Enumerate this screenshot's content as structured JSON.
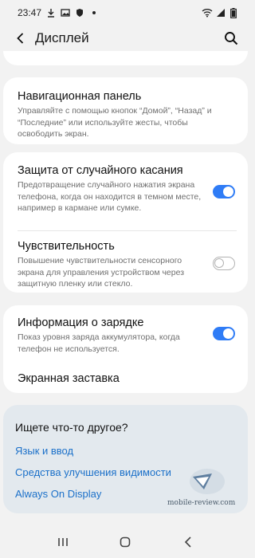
{
  "status_bar": {
    "time": "23:47",
    "left_icons": [
      "download-icon",
      "image-icon",
      "shield-icon",
      "dot-icon"
    ],
    "right_icons": [
      "wifi-icon",
      "signal-icon",
      "battery-icon"
    ]
  },
  "header": {
    "title": "Дисплей"
  },
  "settings": {
    "nav_panel": {
      "title": "Навигационная панель",
      "desc": "Управляйте с помощью кнопок “Домой”, “Назад” и “Последние” или используйте жесты, чтобы освободить экран."
    },
    "accidental_touch": {
      "title": "Защита от случайного касания",
      "desc": "Предотвращение случайного нажатия экрана телефона, когда он находится в темном месте, например в кармане или сумке.",
      "enabled": true
    },
    "sensitivity": {
      "title": "Чувствительность",
      "desc": "Повышение чувствительности сенсорного экрана для управления устройством через защитную пленку или стекло.",
      "enabled": false
    },
    "charging_info": {
      "title": "Информация о зарядке",
      "desc": "Показ уровня заряда аккумулятора, когда телефон не используется.",
      "enabled": true
    },
    "screensaver": {
      "title": "Экранная заставка"
    }
  },
  "suggestions": {
    "title": "Ищете что-то другое?",
    "links": [
      "Язык и ввод",
      "Средства улучшения видимости",
      "Always On Display"
    ]
  },
  "watermark": {
    "text": "mobile-review.com"
  },
  "colors": {
    "accent": "#2f7cf6",
    "link": "#1b70c9",
    "background": "#f2f2f2",
    "suggestion_bg": "#e3e9ee"
  }
}
